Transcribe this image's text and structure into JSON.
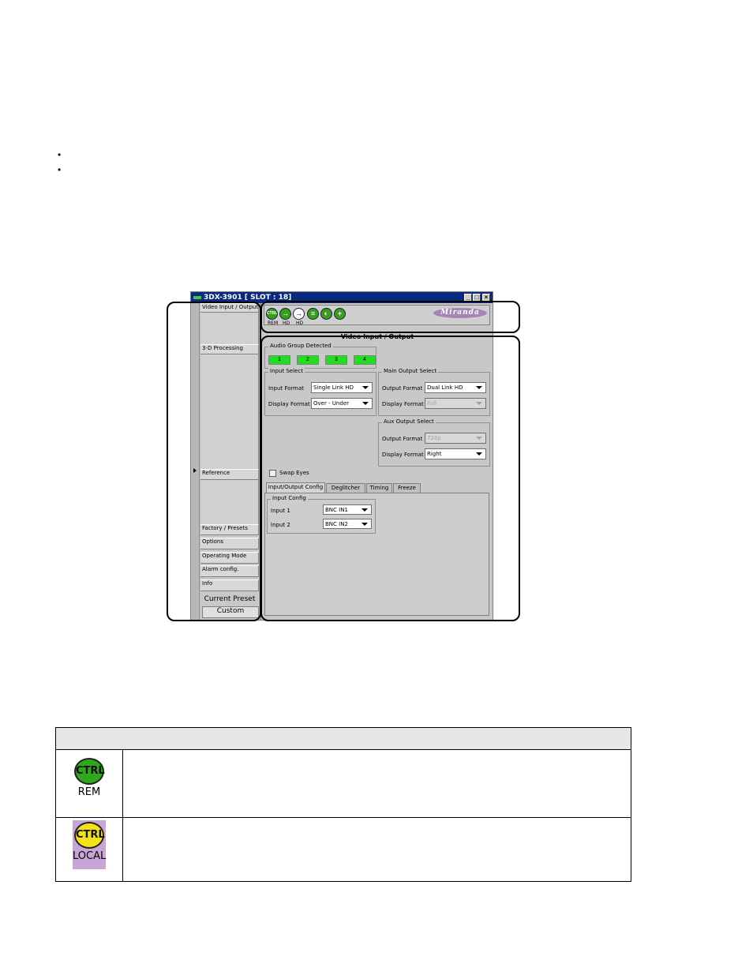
{
  "bullets": [
    "",
    ""
  ],
  "window": {
    "title": "3DX-3901 [ SLOT : 18]",
    "buttons": {
      "minimize": "_",
      "maximize": "□",
      "close": "×"
    },
    "nav": {
      "video_io": "Video Input / Output",
      "processing_3d": "3-D Processing",
      "reference": "Reference",
      "factory_presets": "Factory / Presets",
      "options": "Options",
      "operating_mode": "Operating Mode",
      "alarm_config": "Alarm config.",
      "info": "Info",
      "current_preset": "Current Preset",
      "custom": "Custom"
    },
    "icons": [
      {
        "name": "ctrl-icon",
        "glyph": "CTRL",
        "label": "REM"
      },
      {
        "name": "input-arrow-icon",
        "glyph": "→",
        "label": "HD"
      },
      {
        "name": "output-arrow-icon",
        "glyph": "→",
        "label": "HD"
      },
      {
        "name": "reference-icon",
        "glyph": "≡",
        "label": ""
      },
      {
        "name": "status-icon",
        "glyph": "◐",
        "label": ""
      },
      {
        "name": "add-icon",
        "glyph": "+",
        "label": ""
      }
    ],
    "logo": "Miranda",
    "page_title": "Video Input / Output",
    "audio_group": {
      "title": "Audio Group Detected",
      "groups": [
        "1",
        "2",
        "3",
        "4"
      ]
    },
    "input_select": {
      "title": "Input Select",
      "input_format_label": "Input Format",
      "input_format_value": "Single Link HD",
      "display_format_label": "Display Format",
      "display_format_value": "Over - Under"
    },
    "main_output": {
      "title": "Main Output Select",
      "output_format_label": "Output Format",
      "output_format_value": "Dual Link HD",
      "display_format_label": "Display Format",
      "display_format_value": "Full"
    },
    "aux_output": {
      "title": "Aux Output Select",
      "output_format_label": "Output Format",
      "output_format_value": "720p",
      "display_format_label": "Display Format",
      "display_format_value": "Right"
    },
    "swap_eyes": "Swap Eyes",
    "tabs": [
      "Input/Output Config",
      "Deglitcher",
      "Timing",
      "Freeze"
    ],
    "input_config": {
      "title": "Input Config",
      "input1_label": "Input 1",
      "input1_value": "BNC IN1",
      "input2_label": "Input 2",
      "input2_value": "BNC IN2"
    }
  },
  "legend_table": {
    "header": "",
    "rows": [
      {
        "icon_text": "CTRL",
        "icon_label": "REM",
        "icon_color": "#2fa81e",
        "description": ""
      },
      {
        "icon_text": "CTRL",
        "icon_label": "LOCAL",
        "icon_color": "#f2e21a",
        "description": ""
      }
    ]
  }
}
